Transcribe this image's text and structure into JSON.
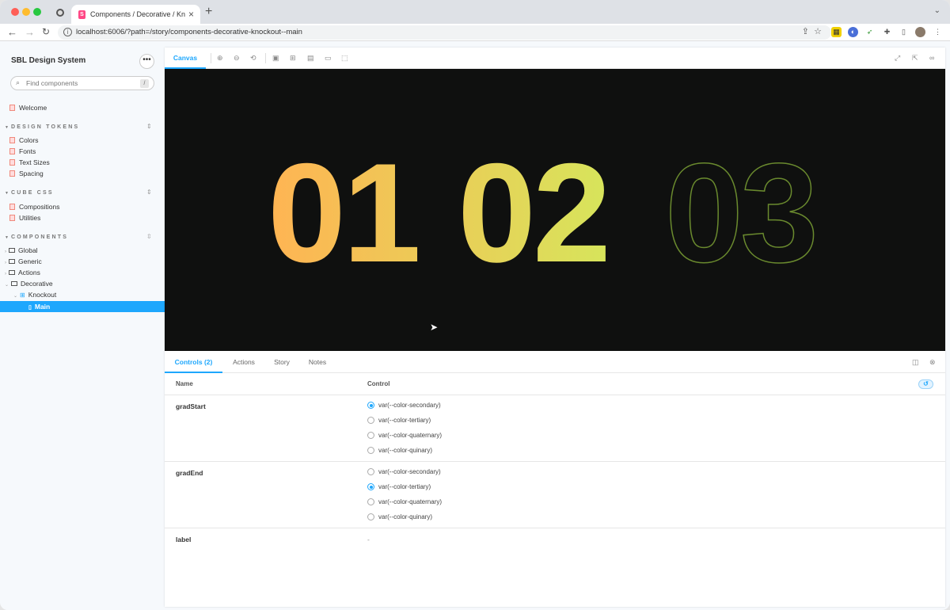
{
  "browser": {
    "tab_title": "Components / Decorative / Knockout - Main",
    "tab_close": "×",
    "new_tab": "+",
    "url": "localhost:6006/?path=/story/components-decorative-knockout--main"
  },
  "sidebar": {
    "brand": "SBL Design System",
    "menu_label": "•••",
    "search_placeholder": "Find components",
    "search_shortcut": "/",
    "welcome": "Welcome",
    "sections": [
      {
        "title": "Design Tokens",
        "items": [
          "Colors",
          "Fonts",
          "Text Sizes",
          "Spacing"
        ]
      },
      {
        "title": "Cube CSS",
        "items": [
          "Compositions",
          "Utilities"
        ]
      },
      {
        "title": "Components",
        "items": [
          "Global",
          "Generic",
          "Actions",
          "Decorative"
        ]
      }
    ],
    "component": "Knockout",
    "story": "Main"
  },
  "toolbar": {
    "canvas_tab": "Canvas"
  },
  "stage": {
    "numbers": [
      "01",
      "02",
      "03"
    ],
    "gradient_start": "#ffb453",
    "gradient_end": "#d4e85c",
    "outline_color": "#6a8a2e",
    "background": "#0f100f"
  },
  "addons": {
    "tabs": [
      "Controls (2)",
      "Actions",
      "Story",
      "Notes"
    ],
    "active_tab": "Controls (2)",
    "header_name": "Name",
    "header_control": "Control",
    "controls": [
      {
        "name": "gradStart",
        "options": [
          "var(--color-secondary)",
          "var(--color-tertiary)",
          "var(--color-quaternary)",
          "var(--color-quinary)"
        ],
        "selected": 0
      },
      {
        "name": "gradEnd",
        "options": [
          "var(--color-secondary)",
          "var(--color-tertiary)",
          "var(--color-quaternary)",
          "var(--color-quinary)"
        ],
        "selected": 1
      },
      {
        "name": "label",
        "value": "-"
      }
    ]
  },
  "colors": {
    "accent": "#1ea7fd",
    "doc_icon": "#f0897d"
  }
}
